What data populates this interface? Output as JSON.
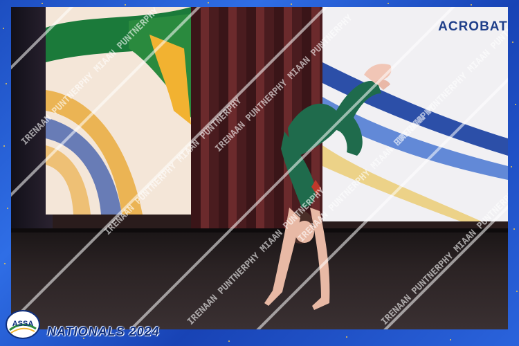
{
  "banner": {
    "text": "ACROBATI"
  },
  "watermark": {
    "text": "IRENAAN PUNTNERPHY MIAAN PUNTNERPHY"
  },
  "logo": {
    "text": "ASSA"
  },
  "event": {
    "title": "NATIONALS 2024"
  },
  "colors": {
    "frame_blue": "#1d4ec0",
    "frame_gold": "#f2c94c",
    "leotard_green": "#1f6b4c",
    "curtain_red": "#6b2a2c",
    "banner_blue": "#1f3f8a"
  }
}
